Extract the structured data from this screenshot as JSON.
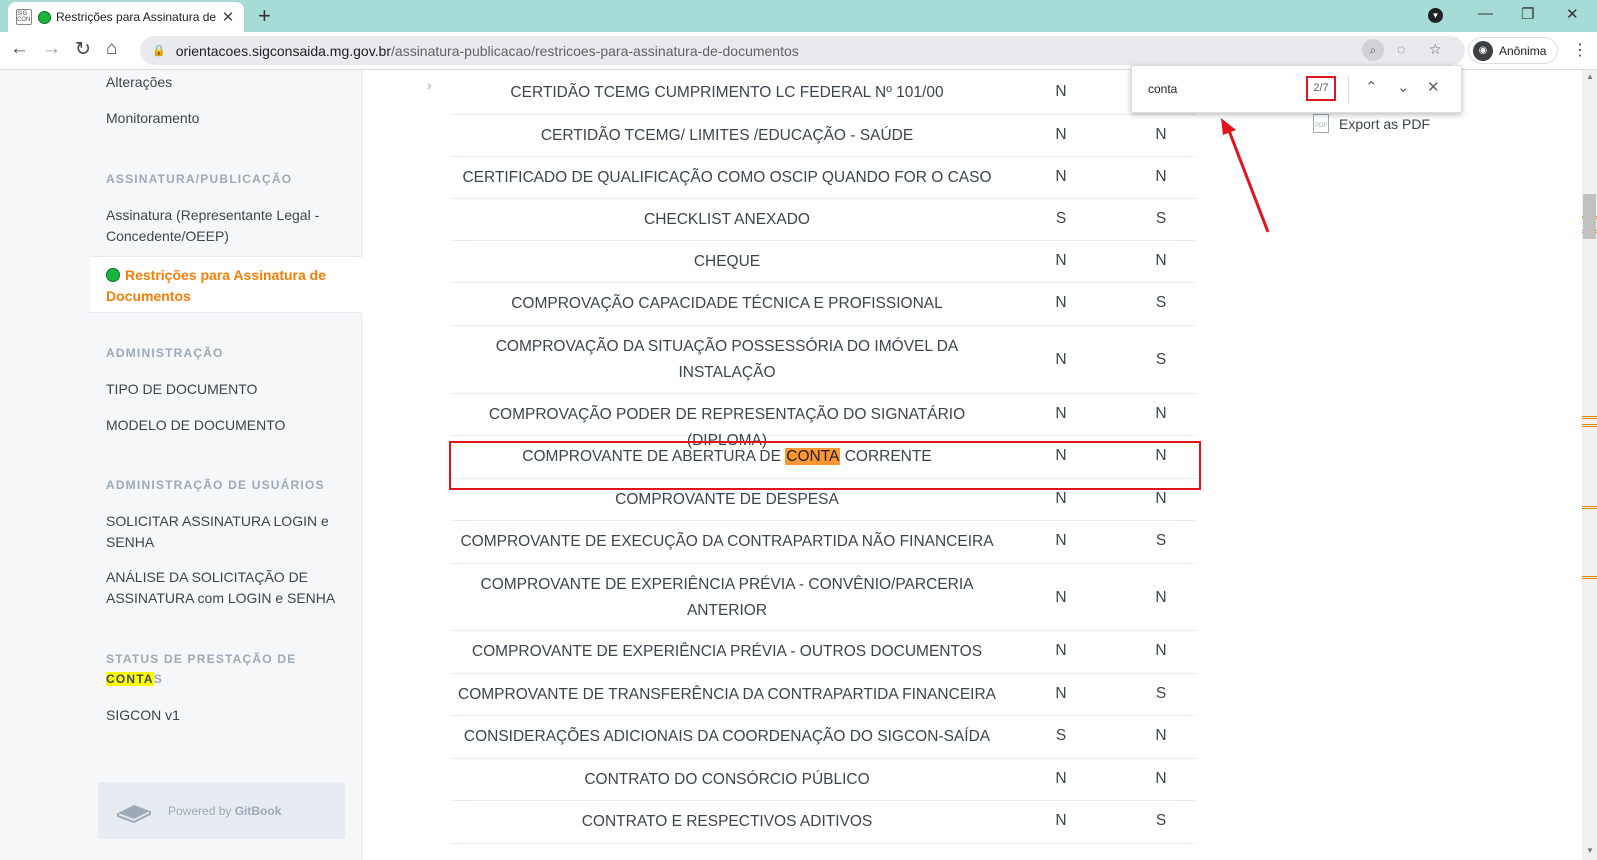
{
  "browser": {
    "tab_title": "Restrições para Assinatura de Documentos",
    "favicon_text": "SIG CON",
    "url_host": "orientacoes.sigconsaida.mg.gov.br",
    "url_path": "/assinatura-publicacao/restricoes-para-assinatura-de-documentos",
    "profile_label": "Anônima"
  },
  "find_bar": {
    "query": "conta",
    "count": "2/7"
  },
  "sidebar": {
    "alteracoes": "Alterações",
    "monitoramento": "Monitoramento",
    "section_assinatura": "ASSINATURA/PUBLICAÇÃO",
    "assinatura_rep": "Assinatura (Representante Legal - Concedente/OEEP)",
    "active_item": "Restrições para Assinatura de Documentos",
    "section_admin": "ADMINISTRAÇÃO",
    "tipo_documento": "TIPO DE DOCUMENTO",
    "modelo_documento": "MODELO DE DOCUMENTO",
    "section_admin_usuarios": "ADMINISTRAÇÃO DE USUÁRIOS",
    "solicitar_assinatura": "SOLICITAR ASSINATURA LOGIN e SENHA",
    "analise_solicitacao": "ANÁLISE DA SOLICITAÇÃO DE ASSINATURA com LOGIN e SENHA",
    "section_status_prefix": "STATUS DE PRESTAÇÃO DE",
    "section_status_match": "CONTA",
    "section_status_suffix": "S",
    "sigcon": "SIGCON v1",
    "powered_prefix": "Powered by",
    "powered_brand": "GitBook"
  },
  "export_pdf": "Export as PDF",
  "table": {
    "rows": [
      {
        "name": "CERTIDÃO TCEMG CUMPRIMENTO LC FEDERAL Nº 101/00",
        "a": "N",
        "b": ""
      },
      {
        "name": "CERTIDÃO TCEMG/ LIMITES /EDUCAÇÃO - SAÚDE",
        "a": "N",
        "b": "N"
      },
      {
        "name": "CERTIFICADO DE QUALIFICAÇÃO COMO OSCIP QUANDO FOR O CASO",
        "a": "N",
        "b": "N"
      },
      {
        "name": "CHECKLIST ANEXADO",
        "a": "S",
        "b": "S"
      },
      {
        "name": "CHEQUE",
        "a": "N",
        "b": "N"
      },
      {
        "name": "COMPROVAÇÃO CAPACIDADE TÉCNICA E PROFISSIONAL",
        "a": "N",
        "b": "S"
      },
      {
        "name": "COMPROVAÇÃO DA SITUAÇÃO POSSESSÓRIA DO IMÓVEL DA INSTALAÇÃO",
        "a": "N",
        "b": "S"
      },
      {
        "name": "COMPROVAÇÃO PODER DE REPRESENTAÇÃO DO SIGNATÁRIO (DIPLOMA)",
        "a": "N",
        "b": "N"
      },
      {
        "name_prefix": "COMPROVANTE DE ABERTURA DE ",
        "name_match": "CONTA",
        "name_suffix": " CORRENTE",
        "a": "N",
        "b": "N"
      },
      {
        "name": "COMPROVANTE DE DESPESA",
        "a": "N",
        "b": "N"
      },
      {
        "name": "COMPROVANTE DE EXECUÇÃO DA CONTRAPARTIDA NÃO FINANCEIRA",
        "a": "N",
        "b": "S"
      },
      {
        "name": "COMPROVANTE DE EXPERIÊNCIA PRÉVIA - CONVÊNIO/PARCERIA ANTERIOR",
        "a": "N",
        "b": "N"
      },
      {
        "name": "COMPROVANTE DE EXPERIÊNCIA PRÉVIA - OUTROS DOCUMENTOS",
        "a": "N",
        "b": "N"
      },
      {
        "name": "COMPROVANTE DE TRANSFERÊNCIA DA CONTRAPARTIDA FINANCEIRA",
        "a": "N",
        "b": "S"
      },
      {
        "name": "CONSIDERAÇÕES ADICIONAIS DA COORDENAÇÃO DO SIGCON-SAÍDA",
        "a": "S",
        "b": "N"
      },
      {
        "name": "CONTRATO DO CONSÓRCIO PÚBLICO",
        "a": "N",
        "b": "N"
      },
      {
        "name": "CONTRATO E RESPECTIVOS ADITIVOS",
        "a": "N",
        "b": "S"
      }
    ]
  },
  "colors": {
    "accent_orange": "#f77d05",
    "find_highlight": "#ff9632",
    "annotation_red": "#e3131b",
    "status_green": "#19b63d"
  }
}
